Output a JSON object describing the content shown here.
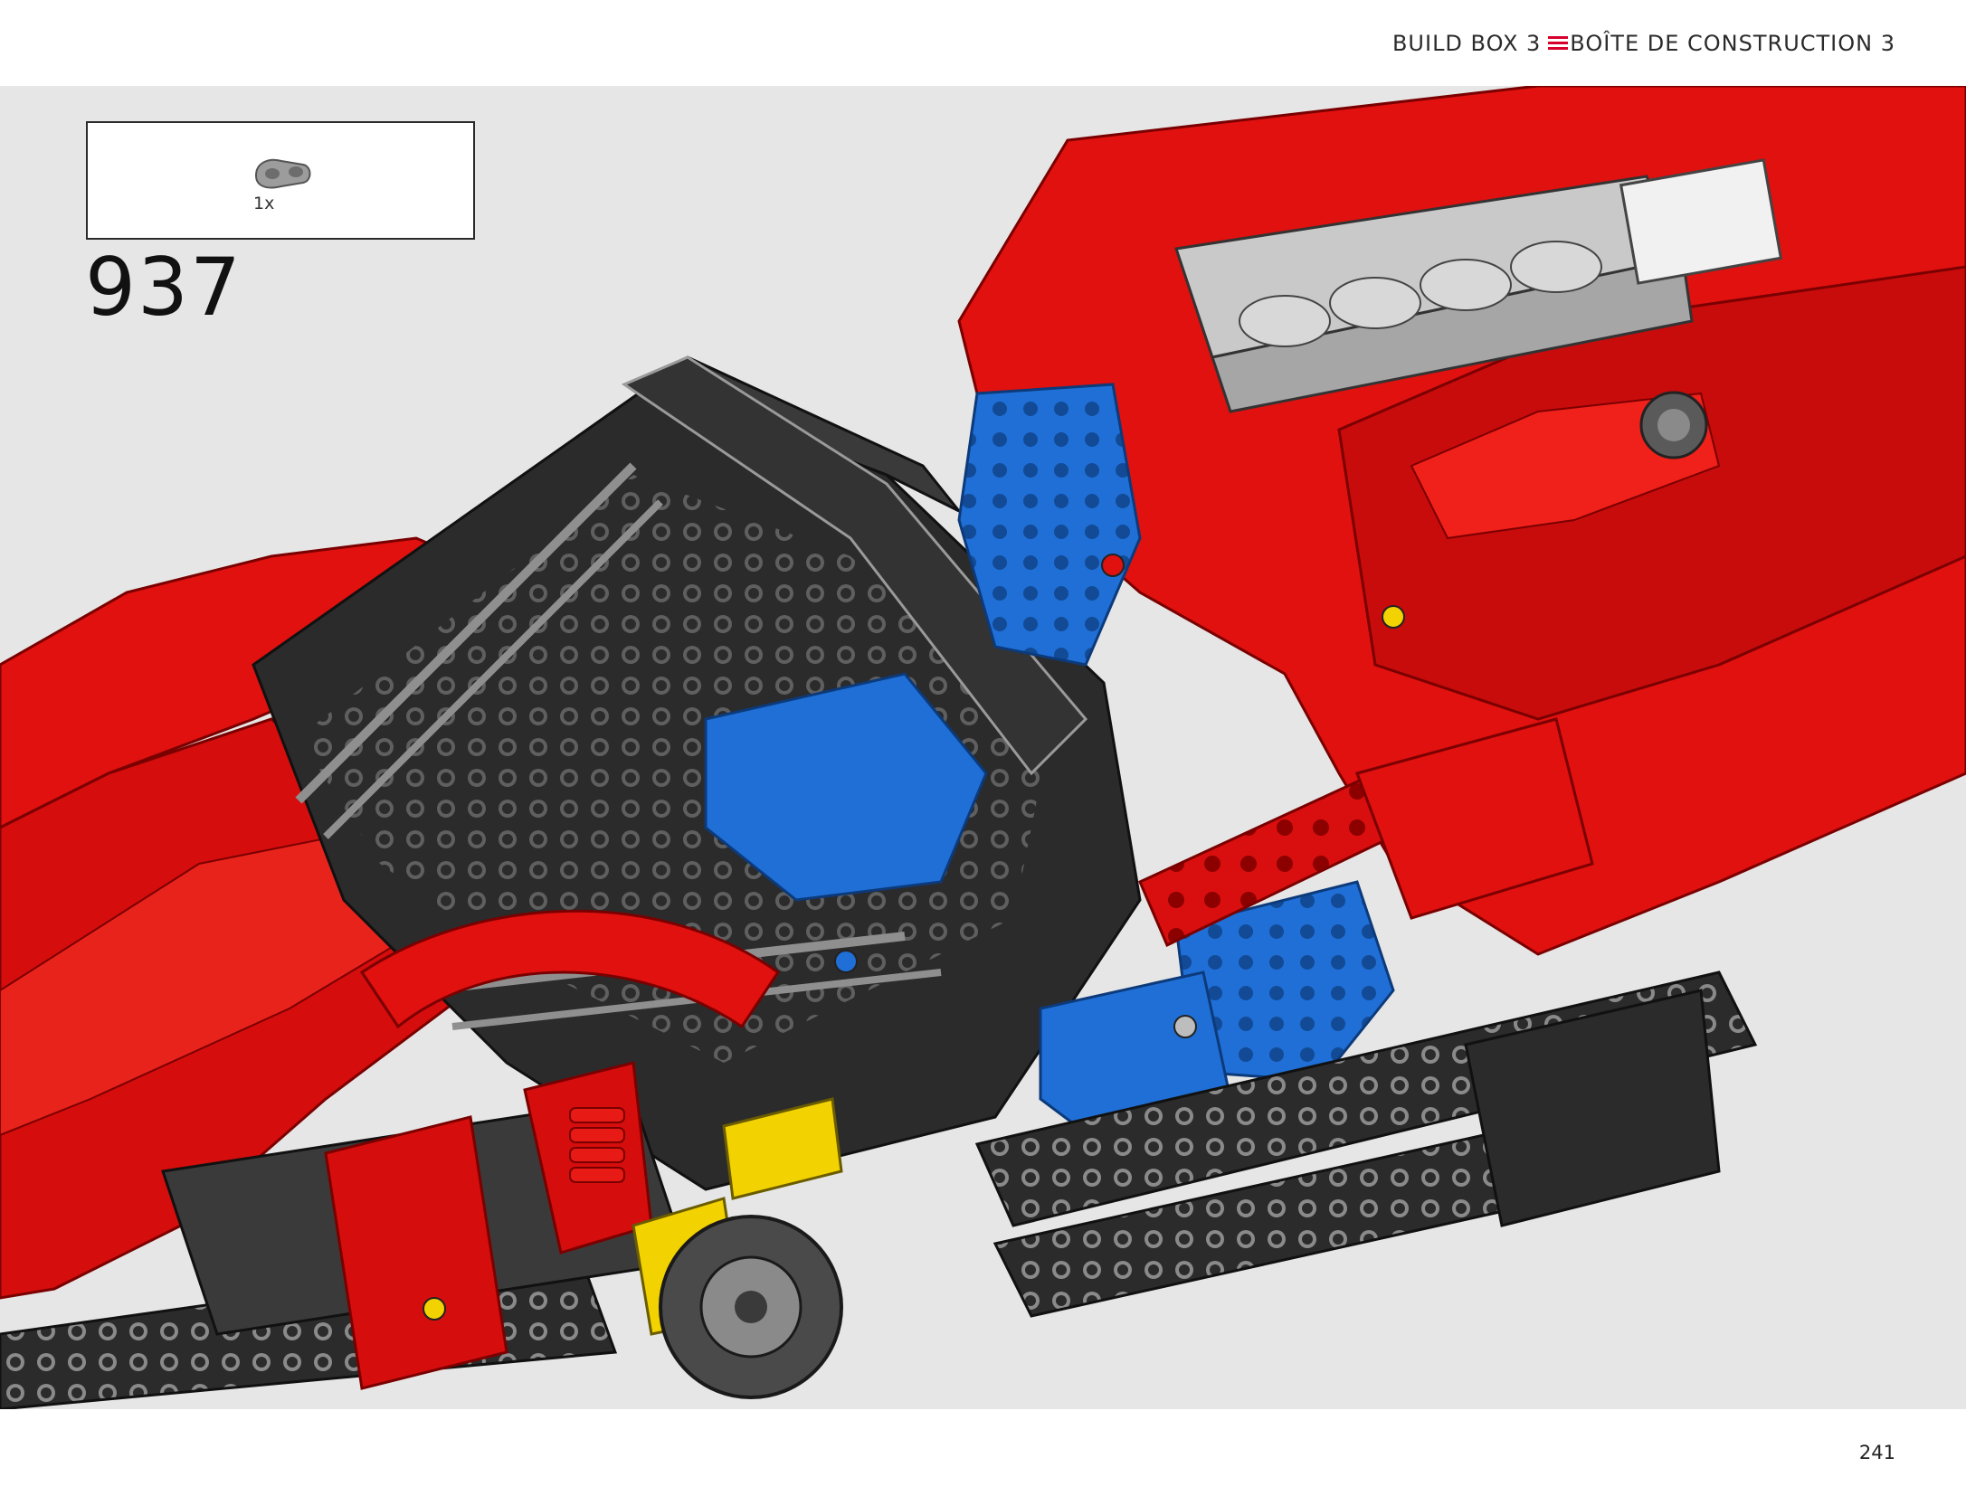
{
  "header": {
    "label_en": "BUILD BOX 3",
    "label_fr": "BOÎTE DE CONSTRUCTION 3",
    "separator_icon": "triple-red-bars",
    "accent_color": "#d7002a"
  },
  "callout": {
    "part_icon": "grey-beam-connector",
    "quantity": "1x"
  },
  "step": {
    "number": "937"
  },
  "illustration": {
    "subject": "red-technic-supercar-chassis",
    "colors": {
      "body": "#e0110f",
      "frame": "#2b2b2b",
      "seats": "#1f6fd6",
      "engine": "#bdbdbd",
      "accents": "#f2d200"
    }
  },
  "footer": {
    "page_number": "241"
  }
}
